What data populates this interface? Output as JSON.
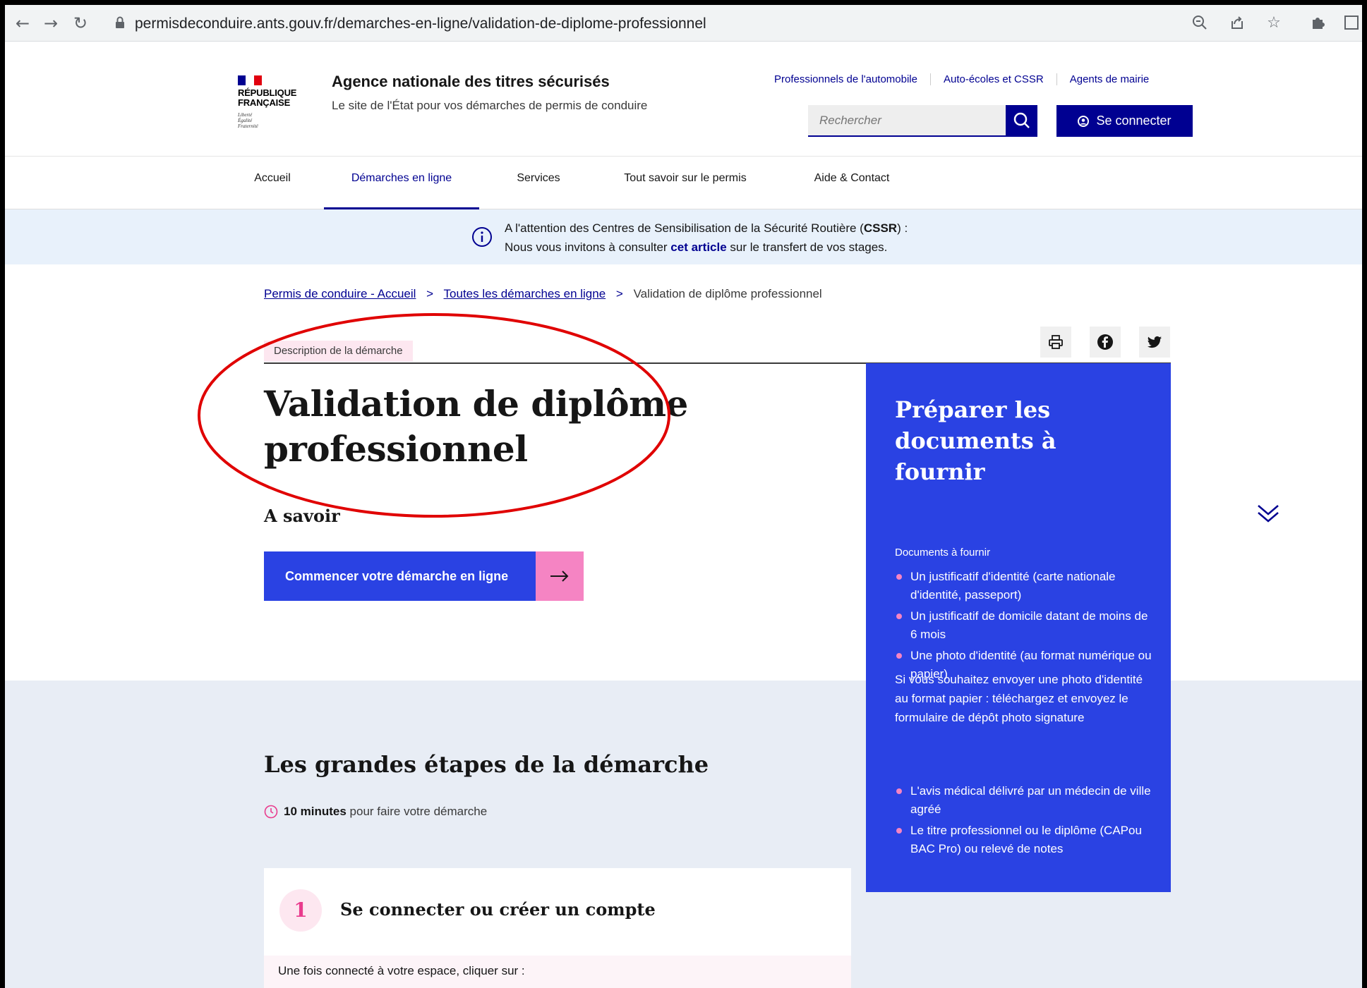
{
  "browser": {
    "url": "permisdeconduire.ants.gouv.fr/demarches-en-ligne/validation-de-diplome-professionnel"
  },
  "header": {
    "logo": {
      "line1": "RÉPUBLIQUE",
      "line2": "FRANÇAISE",
      "motto": [
        "Liberté",
        "Égalité",
        "Fraternité"
      ]
    },
    "agency_name": "Agence nationale des titres sécurisés",
    "agency_tagline": "Le site de l'État pour vos démarches de permis de conduire",
    "top_links": [
      "Professionnels de l'automobile",
      "Auto-écoles et CSSR",
      "Agents de mairie"
    ],
    "search_placeholder": "Rechercher",
    "login_label": "Se connecter"
  },
  "nav": {
    "items": [
      "Accueil",
      "Démarches en ligne",
      "Services",
      "Tout savoir sur le permis",
      "Aide & Contact"
    ],
    "active": "Démarches en ligne"
  },
  "notice": {
    "line1_pre": "A l'attention des Centres de Sensibilisation de la Sécurité Routière (",
    "line1_bold": "CSSR",
    "line1_post": ") :",
    "line2_pre": "Nous vous invitons à consulter ",
    "line2_link": "cet article",
    "line2_post": " sur le transfert de vos stages."
  },
  "breadcrumb": {
    "items": [
      "Permis de conduire - Accueil",
      "Toutes les démarches en ligne"
    ],
    "current": "Validation de diplôme professionnel",
    "separator": ">"
  },
  "main": {
    "tag": "Description de la démarche",
    "title": "Validation de diplôme professionnel",
    "a_savoir": "A savoir",
    "start_button": "Commencer votre démarche en ligne"
  },
  "steps": {
    "title": "Les grandes étapes de la démarche",
    "duration_bold": "10 minutes",
    "duration_rest": "pour faire votre démarche",
    "step1_number": "1",
    "step1_title": "Se connecter ou créer un compte",
    "step1_body": "Une fois connecté à votre espace, cliquer sur :"
  },
  "side_panel": {
    "title": "Préparer les documents à fournir",
    "subtitle": "Documents à fournir",
    "list1": [
      "Un justificatif d'identité (carte nationale d'identité, passeport)",
      "Un justificatif de domicile datant de moins de 6 mois",
      "Une photo d'identité (au format numérique ou papier)"
    ],
    "note": "Si vous souhaitez envoyer une photo d'identité au format papier : téléchargez et envoyez le formulaire de dépôt photo signature",
    "list2": [
      "L'avis médical délivré par un médecin de ville agréé",
      "Le titre professionnel ou le diplôme (CAPou BAC Pro) ou relevé de notes"
    ]
  },
  "colors": {
    "brand_blue": "#000091",
    "panel_blue": "#2a42e3",
    "accent_pink": "#f584c3",
    "annotation_red": "#e00000"
  }
}
